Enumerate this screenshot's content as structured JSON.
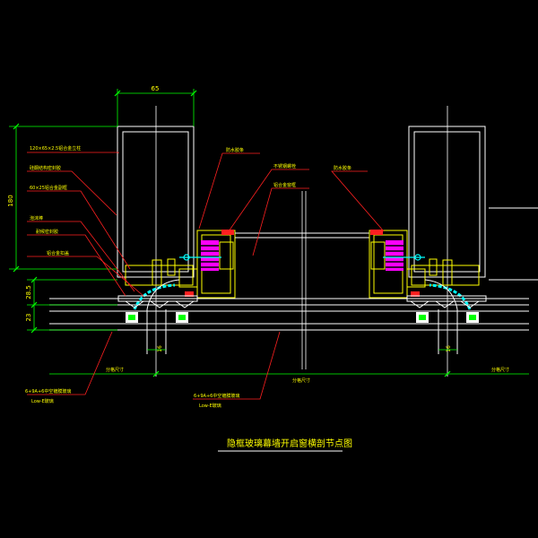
{
  "title": "隐框玻璃幕墙开启窗横剖节点图",
  "dims": {
    "top_width": "65",
    "left_height": "180",
    "left_lower_1": "28.5",
    "left_lower_2": "23",
    "bottom_left": "16",
    "bottom_right": "16"
  },
  "labels": {
    "l1": "120×65×2.5铝合金立柱",
    "l2": "硅酮结构密封胶",
    "l3": "60×25铝合金副框",
    "l4": "泡沫棒",
    "l5": "耐候密封胶",
    "l6": "铝合金扣盖",
    "r1": "防水胶条",
    "r2": "不锈钢螺栓",
    "r3": "铝合金窗框",
    "r4": "防水胶条",
    "glass_left_1": "6+9A+6中空镀膜玻璃",
    "glass_left_2": "Low-E玻璃",
    "glass_mid_1": "6+9A+6中空镀膜玻璃",
    "glass_mid_2": "Low-E玻璃",
    "axis_left": "分格尺寸",
    "axis_mid": "分格尺寸",
    "axis_right": "分格尺寸"
  },
  "colors": {
    "frame": "#ffffff",
    "leader": "#ff2020",
    "dim": "#00ff00",
    "text": "#ffff00",
    "accent": "#ff00ff",
    "aux": "#00ffff"
  }
}
